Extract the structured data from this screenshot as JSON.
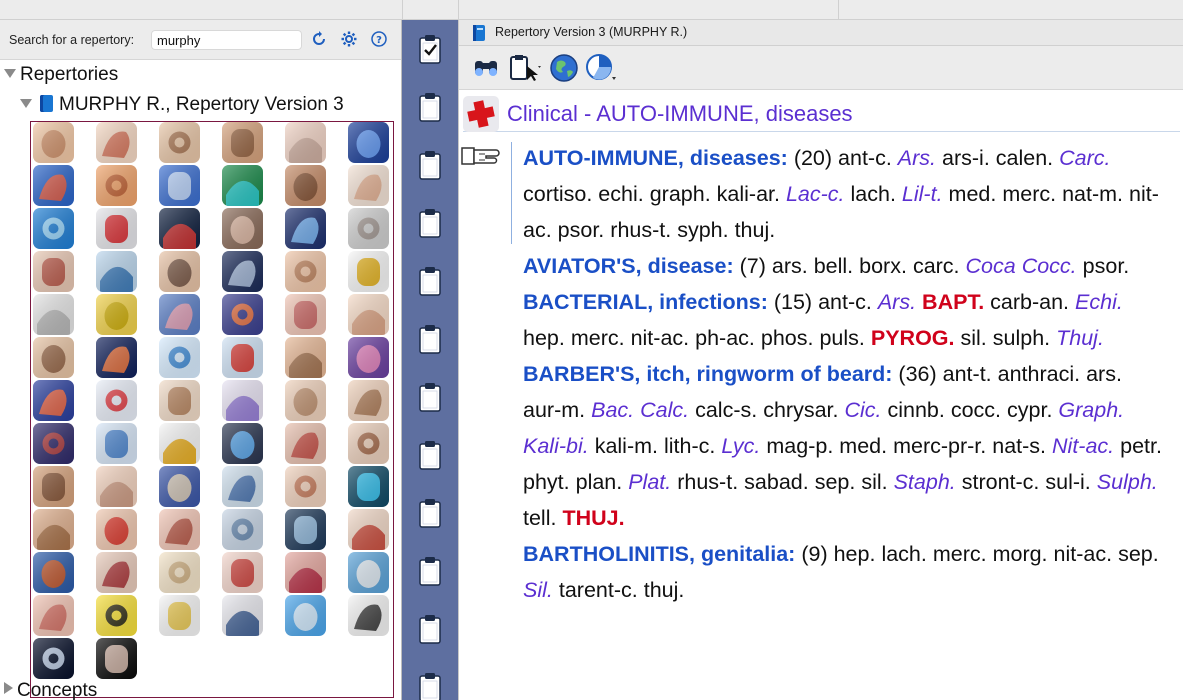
{
  "left_panel": {
    "search_label": "Search for a repertory:",
    "search_value": "murphy",
    "tree": {
      "root_label": "Repertories",
      "child_label": "MURPHY R., Repertory Version 3",
      "next_label": "Concepts"
    },
    "chapter_icons": [
      "abdomen-icon",
      "hand-pain-icon",
      "arm-icon",
      "back-icon",
      "chest-female-icon",
      "knee-xray-icon",
      "brain-red-icon",
      "hand-skin-icon",
      "lungs-icon",
      "virus-green-icon",
      "torso-icon",
      "baby-icon",
      "snowflake-icon",
      "red-cross-clinical-icon",
      "body-red-anatomy-icon",
      "woman-thinking-icon",
      "medical-cross-blue-icon",
      "ear-icon",
      "elbow-icon",
      "eye-icon",
      "face-man-icon",
      "sleep-night-icon",
      "foot-icon",
      "female-symbol-icon",
      "thermometer-fever-icon",
      "pills-yellow-icon",
      "internal-organs-icon",
      "body-glow-icon",
      "throat-icon",
      "hand-open-icon",
      "head-profile-icon",
      "head-brain-icon",
      "ear-inner-icon",
      "arm-joint-icon",
      "skin-icon",
      "intestine-icon",
      "kidneys-back-icon",
      "kidneys-icon",
      "leg-icon",
      "uterus-icon",
      "legs-icon",
      "limbs-icon",
      "liver-icon",
      "lungs-blue-icon",
      "male-symbol-icon",
      "mind-icon",
      "mouth-lips-icon",
      "muscle-arm-icon",
      "neck-back-icon",
      "nose-icon",
      "pelvis-icon",
      "infusion-icon",
      "person-bending-icon",
      "ecg-icon",
      "buttocks-icon",
      "rectum-icon",
      "skin-layers-icon",
      "scanner-icon",
      "head-sound-icon",
      "stomach-icon",
      "stomach-red-icon",
      "throat-organ-icon",
      "smoking-icon",
      "teeth-icon",
      "tongue-throat-icon",
      "clock-icon",
      "tongue-icon",
      "toxicity-icon",
      "syringe-small-icon",
      "syringe-icon",
      "hearing-icon",
      "eye-chart-icon",
      "dark-face-icon",
      "hand-dark-icon"
    ]
  },
  "right_panel": {
    "window_title": "Repertory Version 3 (MURPHY R.)",
    "rubric_heading": "Clinical - AUTO-IMMUNE, diseases",
    "entries": [
      {
        "rubric": "AUTO-IMMUNE, diseases:",
        "count": "(20)",
        "remedies": [
          {
            "t": "ant-c.",
            "s": "rem"
          },
          {
            "t": "Ars.",
            "s": "rem-i"
          },
          {
            "t": "ars-i.",
            "s": "rem"
          },
          {
            "t": "calen.",
            "s": "rem"
          },
          {
            "t": "Carc.",
            "s": "rem-i"
          },
          {
            "t": "cortiso.",
            "s": "rem"
          },
          {
            "t": "echi.",
            "s": "rem"
          },
          {
            "t": "graph.",
            "s": "rem"
          },
          {
            "t": "kali-ar.",
            "s": "rem"
          },
          {
            "t": "Lac-c.",
            "s": "rem-i"
          },
          {
            "t": "lach.",
            "s": "rem"
          },
          {
            "t": "Lil-t.",
            "s": "rem-i"
          },
          {
            "t": "med.",
            "s": "rem"
          },
          {
            "t": "merc.",
            "s": "rem"
          },
          {
            "t": "nat-m.",
            "s": "rem"
          },
          {
            "t": "nit-ac.",
            "s": "rem"
          },
          {
            "t": "psor.",
            "s": "rem"
          },
          {
            "t": "rhus-t.",
            "s": "rem"
          },
          {
            "t": "syph.",
            "s": "rem"
          },
          {
            "t": "thuj.",
            "s": "rem"
          }
        ]
      },
      {
        "rubric": "AVIATOR'S, disease:",
        "count": "(7)",
        "remedies": [
          {
            "t": "ars.",
            "s": "rem"
          },
          {
            "t": "bell.",
            "s": "rem"
          },
          {
            "t": "borx.",
            "s": "rem"
          },
          {
            "t": "carc.",
            "s": "rem"
          },
          {
            "t": "Coca",
            "s": "rem-i"
          },
          {
            "t": "Cocc.",
            "s": "rem-i"
          },
          {
            "t": "psor.",
            "s": "rem"
          }
        ]
      },
      {
        "rubric": "BACTERIAL, infections:",
        "count": "(15)",
        "remedies": [
          {
            "t": "ant-c.",
            "s": "rem"
          },
          {
            "t": "Ars.",
            "s": "rem-i"
          },
          {
            "t": "BAPT.",
            "s": "rem-b"
          },
          {
            "t": "carb-an.",
            "s": "rem"
          },
          {
            "t": "Echi.",
            "s": "rem-i"
          },
          {
            "t": "hep.",
            "s": "rem"
          },
          {
            "t": "merc.",
            "s": "rem"
          },
          {
            "t": "nit-ac.",
            "s": "rem"
          },
          {
            "t": "ph-ac.",
            "s": "rem"
          },
          {
            "t": "phos.",
            "s": "rem"
          },
          {
            "t": "puls.",
            "s": "rem"
          },
          {
            "t": "PYROG.",
            "s": "rem-b"
          },
          {
            "t": "sil.",
            "s": "rem"
          },
          {
            "t": "sulph.",
            "s": "rem"
          },
          {
            "t": "Thuj.",
            "s": "rem-i"
          }
        ]
      },
      {
        "rubric": "BARBER'S, itch, ringworm of beard:",
        "count": "(36)",
        "remedies": [
          {
            "t": "ant-t.",
            "s": "rem"
          },
          {
            "t": "anthraci.",
            "s": "rem"
          },
          {
            "t": "ars.",
            "s": "rem"
          },
          {
            "t": "aur-m.",
            "s": "rem"
          },
          {
            "t": "Bac.",
            "s": "rem-i"
          },
          {
            "t": "Calc.",
            "s": "rem-i"
          },
          {
            "t": "calc-s.",
            "s": "rem"
          },
          {
            "t": "chrysar.",
            "s": "rem"
          },
          {
            "t": "Cic.",
            "s": "rem-i"
          },
          {
            "t": "cinnb.",
            "s": "rem"
          },
          {
            "t": "cocc.",
            "s": "rem"
          },
          {
            "t": "cypr.",
            "s": "rem"
          },
          {
            "t": "Graph.",
            "s": "rem-i"
          },
          {
            "t": "Kali-bi.",
            "s": "rem-i"
          },
          {
            "t": "kali-m.",
            "s": "rem"
          },
          {
            "t": "lith-c.",
            "s": "rem"
          },
          {
            "t": "Lyc.",
            "s": "rem-i"
          },
          {
            "t": "mag-p.",
            "s": "rem"
          },
          {
            "t": "med.",
            "s": "rem"
          },
          {
            "t": "merc-pr-r.",
            "s": "rem"
          },
          {
            "t": "nat-s.",
            "s": "rem"
          },
          {
            "t": "Nit-ac.",
            "s": "rem-i"
          },
          {
            "t": "petr.",
            "s": "rem"
          },
          {
            "t": "phyt.",
            "s": "rem"
          },
          {
            "t": "plan.",
            "s": "rem"
          },
          {
            "t": "Plat.",
            "s": "rem-i"
          },
          {
            "t": "rhus-t.",
            "s": "rem"
          },
          {
            "t": "sabad.",
            "s": "rem"
          },
          {
            "t": "sep.",
            "s": "rem"
          },
          {
            "t": "sil.",
            "s": "rem"
          },
          {
            "t": "Staph.",
            "s": "rem-i"
          },
          {
            "t": "stront-c.",
            "s": "rem"
          },
          {
            "t": "sul-i.",
            "s": "rem"
          },
          {
            "t": "Sulph.",
            "s": "rem-i"
          },
          {
            "t": "tell.",
            "s": "rem"
          },
          {
            "t": "THUJ.",
            "s": "rem-b"
          }
        ]
      },
      {
        "rubric": "BARTHOLINITIS, genitalia:",
        "count": "(9)",
        "remedies": [
          {
            "t": "hep.",
            "s": "rem"
          },
          {
            "t": "lach.",
            "s": "rem"
          },
          {
            "t": "merc.",
            "s": "rem"
          },
          {
            "t": "morg.",
            "s": "rem"
          },
          {
            "t": "nit-ac.",
            "s": "rem"
          },
          {
            "t": "sep.",
            "s": "rem"
          },
          {
            "t": "Sil.",
            "s": "rem-i"
          },
          {
            "t": "tarent-c.",
            "s": "rem"
          },
          {
            "t": "thuj.",
            "s": "rem"
          }
        ]
      }
    ]
  },
  "colors": {
    "rubric": "#1a4fc6",
    "italic_remedy": "#5b2fd1",
    "bold_remedy": "#d0021b",
    "clip_strip": "#5e6fa0",
    "grid_border": "#7a1740"
  }
}
